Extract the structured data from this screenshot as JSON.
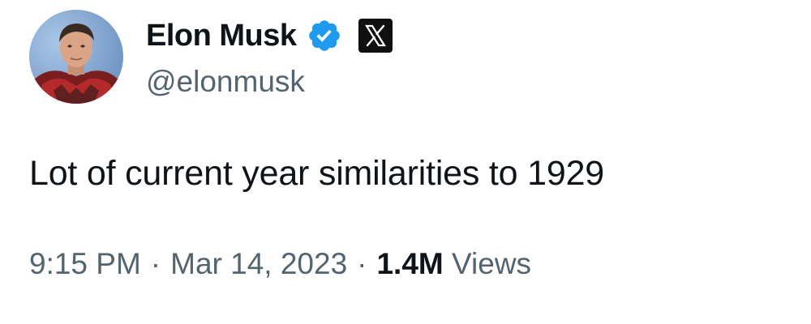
{
  "author": {
    "display_name": "Elon Musk",
    "handle": "@elonmusk",
    "verified_color": "#1d9bf0",
    "affiliation_badge_icon": "x-logo-icon"
  },
  "tweet": {
    "text": "Lot of current year similarities to 1929"
  },
  "meta": {
    "time": "9:15 PM",
    "separator": "·",
    "date": "Mar 14, 2023",
    "views_count": "1.4M",
    "views_label": "Views"
  },
  "colors": {
    "text_primary": "#0f1419",
    "text_secondary": "#536471",
    "verified": "#1d9bf0"
  }
}
